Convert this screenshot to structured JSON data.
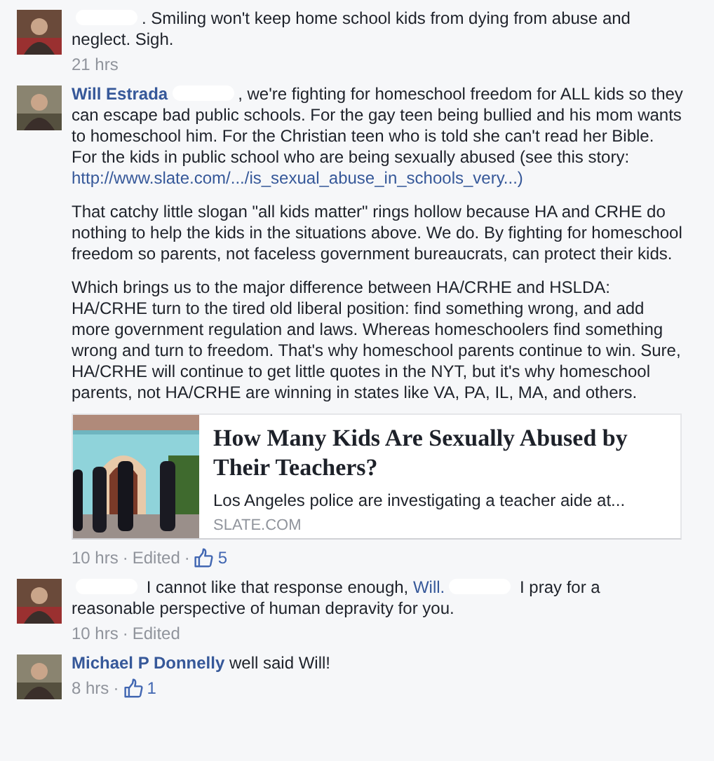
{
  "comments": [
    {
      "body": [
        [
          {
            "kind": "redaction"
          },
          {
            "kind": "text",
            "text": ". Smiling won't keep home school kids from dying from abuse and neglect. Sigh."
          }
        ]
      ],
      "meta": [
        {
          "kind": "time",
          "text": "21 hrs"
        }
      ]
    },
    {
      "body": [
        [
          {
            "kind": "author",
            "text": "Will Estrada"
          },
          {
            "kind": "redaction"
          },
          {
            "kind": "text",
            "text": ", we're fighting for homeschool freedom for ALL kids so they can escape bad public schools. For the gay teen being bullied and his mom wants to homeschool him. For the Christian teen who is told she can't read her Bible. For the kids in public school who are being sexually abused (see this story: "
          },
          {
            "kind": "link",
            "text": "http://www.slate.com/.../is_sexual_abuse_in_schools_very...)"
          }
        ],
        [
          {
            "kind": "text",
            "text": "That catchy little slogan \"all kids matter\" rings hollow because HA and CRHE do nothing to help the kids in the situations above. We do. By fighting for homeschool freedom so parents, not faceless government bureaucrats, can protect their kids."
          }
        ],
        [
          {
            "kind": "text",
            "text": "Which brings us to the major difference between HA/CRHE and HSLDA: HA/CRHE turn to the tired old liberal position: find something wrong, and add more government regulation and laws. Whereas homeschoolers find something wrong and turn to freedom. That's why homeschool parents continue to win. Sure, HA/CRHE will continue to get little quotes in the NYT, but it's why homeschool parents, not HA/CRHE are winning in states like VA, PA, IL, MA, and others."
          }
        ]
      ],
      "preview": {
        "title": "How Many Kids Are Sexually Abused by Their Teachers?",
        "description": "Los Angeles police are investigating a teacher aide at...",
        "source": "SLATE.COM"
      },
      "meta": [
        {
          "kind": "time",
          "text": "10 hrs"
        },
        {
          "kind": "sep",
          "text": "·"
        },
        {
          "kind": "edited",
          "text": "Edited"
        },
        {
          "kind": "sep",
          "text": "·"
        },
        {
          "kind": "likes",
          "text": "5"
        }
      ]
    },
    {
      "body": [
        [
          {
            "kind": "redaction"
          },
          {
            "kind": "text",
            "text": " I cannot like that response enough, "
          },
          {
            "kind": "link",
            "text": "Will."
          },
          {
            "kind": "redaction"
          },
          {
            "kind": "text",
            "text": " I pray for a reasonable perspective of human depravity for you."
          }
        ]
      ],
      "meta": [
        {
          "kind": "time",
          "text": "10 hrs"
        },
        {
          "kind": "sep",
          "text": "·"
        },
        {
          "kind": "edited",
          "text": "Edited"
        }
      ]
    },
    {
      "body": [
        [
          {
            "kind": "author",
            "text": "Michael P Donnelly"
          },
          {
            "kind": "text",
            "text": " well said Will!"
          }
        ]
      ],
      "meta": [
        {
          "kind": "time",
          "text": "8 hrs"
        },
        {
          "kind": "sep",
          "text": "·"
        },
        {
          "kind": "likes",
          "text": "1"
        }
      ]
    }
  ]
}
